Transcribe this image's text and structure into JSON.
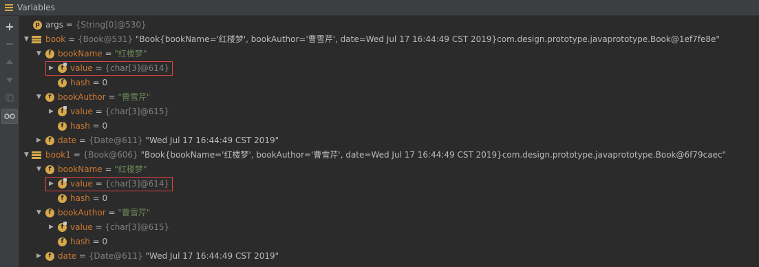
{
  "panel": {
    "title": "Variables"
  },
  "toolbar": {
    "buttons": [
      "plus-icon",
      "minus-icon",
      "up-icon",
      "down-icon",
      "copy-icon",
      "watch-icon"
    ]
  },
  "rows": [
    {
      "depth": 0,
      "arrow": "",
      "icon": "p",
      "name": "args",
      "name_class": "name plain",
      "eq": " = ",
      "type": "{String[0]@530}",
      "value": ""
    },
    {
      "depth": 0,
      "arrow": "▼",
      "icon": "stack",
      "name": "book",
      "name_class": "name",
      "eq": " = ",
      "type": "{Book@531}",
      "value": " \"Book{bookName='红楼梦', bookAuthor='曹雪芹', date=Wed Jul 17 16:44:49 CST 2019}com.design.prototype.javaprototype.Book@1ef7fe8e\""
    },
    {
      "depth": 1,
      "arrow": "▼",
      "icon": "f",
      "name": "bookName",
      "name_class": "name",
      "eq": " = ",
      "type": "",
      "value": "\"红楼梦\"",
      "value_class": "str"
    },
    {
      "depth": 2,
      "arrow": "▶",
      "icon": "f-lock",
      "name": "value",
      "name_class": "name",
      "eq": " = ",
      "type": "{char[3]@614}",
      "value": "",
      "hl": true
    },
    {
      "depth": 2,
      "arrow": "",
      "icon": "f",
      "name": "hash",
      "name_class": "name",
      "eq": " = ",
      "type": "",
      "value": "0",
      "value_class": "val"
    },
    {
      "depth": 1,
      "arrow": "▼",
      "icon": "f",
      "name": "bookAuthor",
      "name_class": "name",
      "eq": " = ",
      "type": "",
      "value": "\"曹雪芹\"",
      "value_class": "str"
    },
    {
      "depth": 2,
      "arrow": "▶",
      "icon": "f-lock",
      "name": "value",
      "name_class": "name",
      "eq": " = ",
      "type": "{char[3]@615}",
      "value": ""
    },
    {
      "depth": 2,
      "arrow": "",
      "icon": "f",
      "name": "hash",
      "name_class": "name",
      "eq": " = ",
      "type": "",
      "value": "0",
      "value_class": "val"
    },
    {
      "depth": 1,
      "arrow": "▶",
      "icon": "f",
      "name": "date",
      "name_class": "name",
      "eq": " = ",
      "type": "{Date@611}",
      "value": " \"Wed Jul 17 16:44:49 CST 2019\""
    },
    {
      "depth": 0,
      "arrow": "▼",
      "icon": "stack",
      "name": "book1",
      "name_class": "name",
      "eq": " = ",
      "type": "{Book@606}",
      "value": " \"Book{bookName='红楼梦', bookAuthor='曹雪芹', date=Wed Jul 17 16:44:49 CST 2019}com.design.prototype.javaprototype.Book@6f79caec\""
    },
    {
      "depth": 1,
      "arrow": "▼",
      "icon": "f",
      "name": "bookName",
      "name_class": "name",
      "eq": " = ",
      "type": "",
      "value": "\"红楼梦\"",
      "value_class": "str"
    },
    {
      "depth": 2,
      "arrow": "▶",
      "icon": "f-lock",
      "name": "value",
      "name_class": "name",
      "eq": " = ",
      "type": "{char[3]@614}",
      "value": "",
      "hl": true
    },
    {
      "depth": 2,
      "arrow": "",
      "icon": "f",
      "name": "hash",
      "name_class": "name",
      "eq": " = ",
      "type": "",
      "value": "0",
      "value_class": "val"
    },
    {
      "depth": 1,
      "arrow": "▼",
      "icon": "f",
      "name": "bookAuthor",
      "name_class": "name",
      "eq": " = ",
      "type": "",
      "value": "\"曹雪芹\"",
      "value_class": "str"
    },
    {
      "depth": 2,
      "arrow": "▶",
      "icon": "f-lock",
      "name": "value",
      "name_class": "name",
      "eq": " = ",
      "type": "{char[3]@615}",
      "value": ""
    },
    {
      "depth": 2,
      "arrow": "",
      "icon": "f",
      "name": "hash",
      "name_class": "name",
      "eq": " = ",
      "type": "",
      "value": "0",
      "value_class": "val"
    },
    {
      "depth": 1,
      "arrow": "▶",
      "icon": "f",
      "name": "date",
      "name_class": "name",
      "eq": " = ",
      "type": "{Date@611}",
      "value": " \"Wed Jul 17 16:44:49 CST 2019\""
    }
  ],
  "colors": {
    "background": "#2b2b2b",
    "field_name": "#cc7832",
    "string": "#6a8759",
    "type_ref": "#808080",
    "highlight_box": "#e04343",
    "icon": "#d6a84a"
  }
}
